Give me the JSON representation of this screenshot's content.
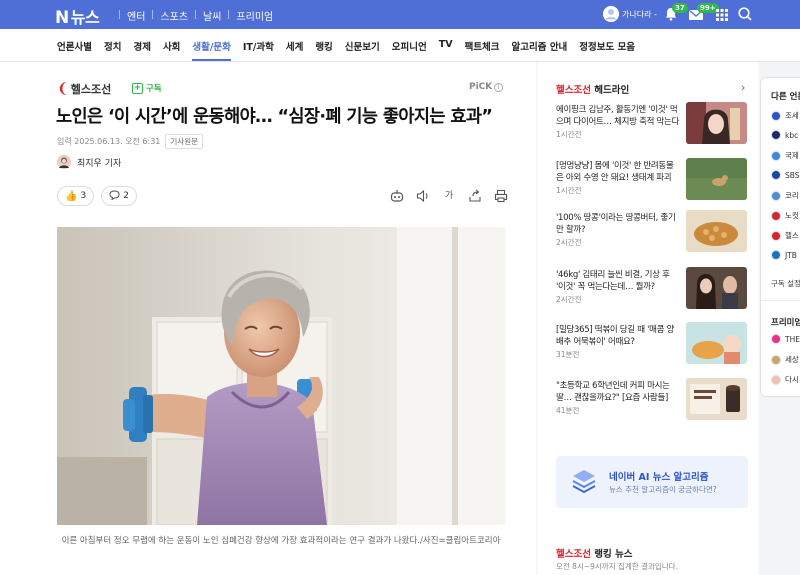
{
  "topbar": {
    "logo_n": "N",
    "logo_text": "뉴스",
    "links": [
      "엔터",
      "스포츠",
      "날씨",
      "프리미엄"
    ],
    "user_name": "가나다라 -",
    "caret": "▾",
    "bell_badge": "37",
    "mail_badge": "99+"
  },
  "categories": [
    {
      "label": "언론사별"
    },
    {
      "label": "정치"
    },
    {
      "label": "경제"
    },
    {
      "label": "사회"
    },
    {
      "label": "생활/문화",
      "active": true
    },
    {
      "label": "IT/과학"
    },
    {
      "label": "세계"
    },
    {
      "label": "랭킹"
    },
    {
      "label": "신문보기"
    },
    {
      "label": "오피니언"
    },
    {
      "label": "TV"
    },
    {
      "label": "팩트체크"
    },
    {
      "label": "알고리즘 안내"
    },
    {
      "label": "정정보도 모음"
    }
  ],
  "article": {
    "press": "헬스조선",
    "subscribe": "구독",
    "pick": "PiCK",
    "headline": "노인은 ‘이 시간’에 운동해야… “심장·폐 기능 좋아지는 효과”",
    "date": "입력 2025.06.13. 오전 6:31",
    "original_button": "기사원문",
    "reporter": "최지우 기자",
    "reaction_count": "3",
    "comment_count": "2",
    "font_tool": "가",
    "caption": "이른 아침부터 정오 무렵에 하는 운동이 노인 심폐건강 향상에 가장 효과적이라는 연구 결과가 나왔다./사진=클립아트코리아"
  },
  "sidebar": {
    "press": "헬스조선",
    "heading": "헤드라인",
    "chevron": "›",
    "news": [
      {
        "title": "에이핑크 김남주, 활동기엔 '이것' 먹으며 다이어트… 체지방 축적 막는다",
        "time": "1시간전"
      },
      {
        "title": "[멍멍냥냥] 몸에 '이것' 한 반려동물은 아외 수영 안 돼요! 생태계 파괴",
        "time": "1시간전"
      },
      {
        "title": "'100% 땅콩'이라는 땅콩버터, 좋기만 할까?",
        "time": "2시간전"
      },
      {
        "title": "'46kg' 김태리 늘씬 비결, 기상 후 '이것' 꼭 먹는다는데… 뭘까?",
        "time": "2시간전"
      },
      {
        "title": "[밀당365] 떡볶이 당길 때 '매콤 양배추 어묵볶이' 어때요?",
        "time": "31분전"
      },
      {
        "title": "\"초등학교 6학년인데 커피 마시는 딸… 괜찮을까요?\" [요즘 사람들]",
        "time": "41분전"
      }
    ],
    "ai_title": "네이버 AI 뉴스 알고리즘",
    "ai_sub": "뉴스 추천 알고리즘이 궁금하다면?",
    "rank_heading": "랭킹 뉴스",
    "rank_sub": "오전 8시~9시까지 집계한 결과입니다."
  },
  "far_panel": {
    "heading": "다른 언론",
    "items": [
      "조세",
      "kbc",
      "국제",
      "SBS",
      "코리",
      "노컷",
      "헬스",
      "JTB"
    ],
    "subscribe_btn": "구독 설정",
    "premium_heading": "프리미엄",
    "premium_items": [
      "THE",
      "세상",
      "다시"
    ]
  },
  "colors": {
    "brand_blue": "#4f6fd6",
    "press_red": "#d8242c",
    "subscribe_green": "#2fb94a"
  }
}
